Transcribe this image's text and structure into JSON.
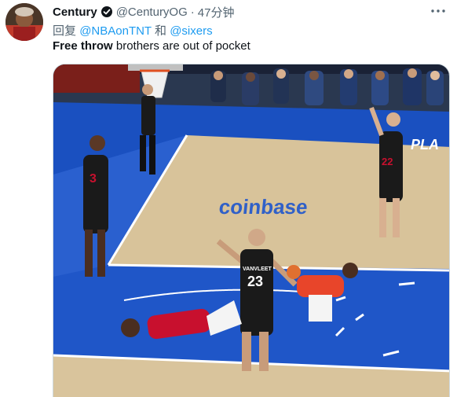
{
  "tweet": {
    "author_name": "Century",
    "author_handle": "@CenturyOG",
    "separator": "·",
    "time": "47分钟",
    "reply_prefix": "回复",
    "reply_mention_1": "@NBAonTNT",
    "reply_and": "和",
    "reply_mention_2": "@sixers",
    "text_bold": "Free throw",
    "text_rest": " brothers are out of pocket"
  },
  "media": {
    "court_sign": "coinbase",
    "court_logo_fragment": "PLA",
    "jersey_numbers": [
      "3",
      "22",
      "23"
    ],
    "jersey_name": "VANVLEET"
  },
  "icons": {
    "verified": "verified-badge-icon",
    "more": "more-options-icon"
  },
  "colors": {
    "link": "#1d9bf0",
    "secondary_text": "#536471",
    "primary_text": "#0f1419"
  }
}
